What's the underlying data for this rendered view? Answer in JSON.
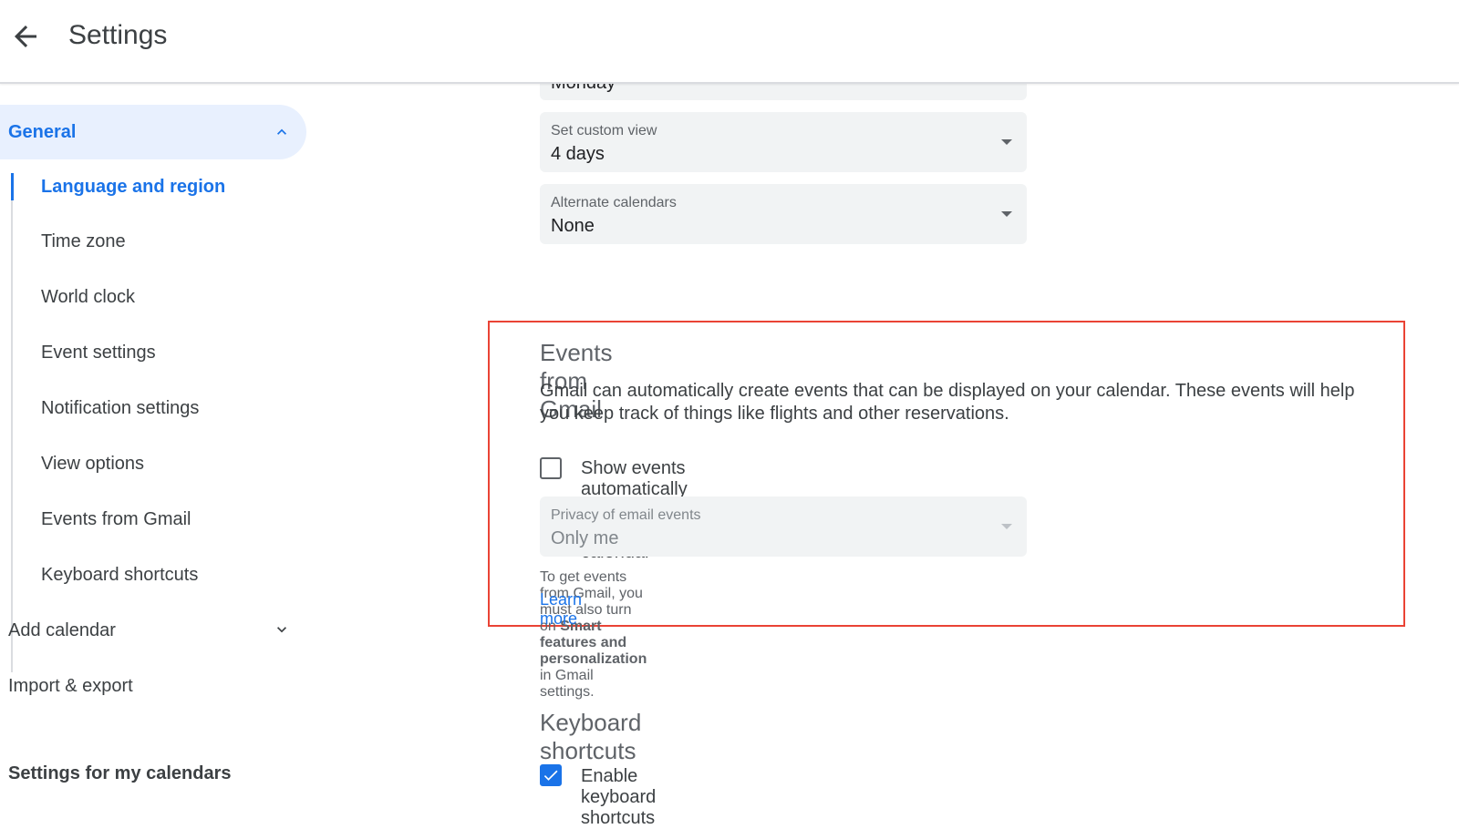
{
  "header": {
    "title": "Settings",
    "back_icon": "arrow-back-icon"
  },
  "sidebar": {
    "general": {
      "label": "General",
      "expanded": true
    },
    "sub_items": [
      {
        "label": "Language and region",
        "active": true
      },
      {
        "label": "Time zone"
      },
      {
        "label": "World clock"
      },
      {
        "label": "Event settings"
      },
      {
        "label": "Notification settings"
      },
      {
        "label": "View options"
      },
      {
        "label": "Events from Gmail"
      },
      {
        "label": "Keyboard shortcuts"
      }
    ],
    "add_calendar": "Add calendar",
    "import_export": "Import & export",
    "my_calendars": "Settings for my calendars"
  },
  "main": {
    "week_start": {
      "value": "Monday"
    },
    "custom_view": {
      "label": "Set custom view",
      "value": "4 days"
    },
    "alternate_calendars": {
      "label": "Alternate calendars",
      "value": "None"
    },
    "events_from_gmail": {
      "title": "Events from Gmail",
      "description": "Gmail can automatically create events that can be displayed on your calendar. These events will help you keep track of things like flights and other reservations.",
      "checkbox_label": "Show events automatically created by Gmail in my calendar",
      "checked": false,
      "privacy": {
        "label": "Privacy of email events",
        "value": "Only me",
        "disabled": true
      },
      "note_before": "To get events from Gmail, you must also turn on ",
      "note_bold": "Smart features and personalization",
      "note_after": " in Gmail settings.",
      "learn_more": "Learn more"
    },
    "keyboard_shortcuts": {
      "title": "Keyboard shortcuts",
      "checkbox_label": "Enable keyboard shortcuts",
      "checked": true
    }
  },
  "colors": {
    "accent": "#1a73e8",
    "highlight_border": "#ea4335",
    "field_bg": "#f1f3f4"
  }
}
